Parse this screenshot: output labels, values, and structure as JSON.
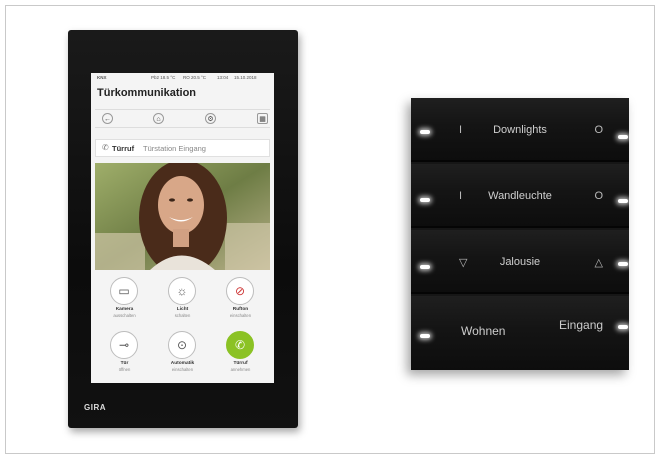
{
  "touch_panel": {
    "brand": "GIRA",
    "status_bar": {
      "system": "KNX",
      "temp1": "Pb2 18.5 °C",
      "temp2": "RO 20.5 °C",
      "time": "13:04",
      "date": "15.10.2018"
    },
    "title": "Türkommunikation",
    "nav_icons": [
      "back-arrow-icon",
      "home-icon",
      "settings-icon",
      "grid-icon"
    ],
    "door_bar": {
      "label": "Türruf",
      "sub": "Türstation Eingang"
    },
    "actions": [
      {
        "label": "Kamera",
        "sub": "ausschalten",
        "icon": "camera-icon"
      },
      {
        "label": "Licht",
        "sub": "schalten",
        "icon": "light-icon"
      },
      {
        "label": "Rufton",
        "sub": "einschalten",
        "icon": "bell-off-icon"
      },
      {
        "label": "Tür",
        "sub": "öffnen",
        "icon": "key-icon"
      },
      {
        "label": "Automatik",
        "sub": "einschalten",
        "icon": "auto-open-icon"
      },
      {
        "label": "Türruf",
        "sub": "annehmen",
        "icon": "phone-icon"
      }
    ]
  },
  "sensor": {
    "rows": [
      {
        "label": "Downlights",
        "left": "I",
        "right": "O"
      },
      {
        "label": "Wandleuchte",
        "left": "I",
        "right": "O"
      },
      {
        "label": "Jalousie",
        "left": "▽",
        "right": "△"
      }
    ],
    "bottom": {
      "left": "Wohnen",
      "right": "Eingang"
    }
  }
}
